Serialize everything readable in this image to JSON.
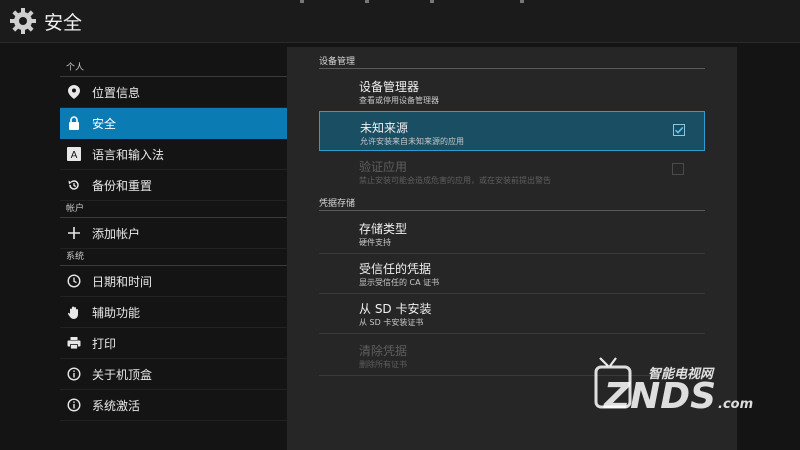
{
  "header": {
    "title": "安全",
    "icon": "gear-icon"
  },
  "sidebar": {
    "groups": [
      {
        "label": "个人",
        "items": [
          {
            "label": "位置信息",
            "icon": "location-pin-icon"
          },
          {
            "label": "安全",
            "icon": "lock-icon",
            "active": true
          },
          {
            "label": "语言和输入法",
            "icon": "keyboard-a-icon"
          },
          {
            "label": "备份和重置",
            "icon": "backup-icon"
          }
        ]
      },
      {
        "label": "帐户",
        "items": [
          {
            "label": "添加帐户",
            "icon": "plus-icon"
          }
        ]
      },
      {
        "label": "系统",
        "items": [
          {
            "label": "日期和时间",
            "icon": "clock-icon"
          },
          {
            "label": "辅助功能",
            "icon": "hand-icon"
          },
          {
            "label": "打印",
            "icon": "printer-icon"
          },
          {
            "label": "关于机顶盒",
            "icon": "info-icon"
          },
          {
            "label": "系统激活",
            "icon": "info-icon"
          }
        ]
      }
    ]
  },
  "main": {
    "sections": [
      {
        "header": "设备管理",
        "items": [
          {
            "title": "设备管理器",
            "summary": "查看或停用设备管理器"
          },
          {
            "title": "未知来源",
            "summary": "允许安装来自未知来源的应用",
            "checkbox": true,
            "checked": true,
            "selected": true
          },
          {
            "title": "验证应用",
            "summary": "禁止安装可能会造成危害的应用，或在安装前提出警告",
            "checkbox": true,
            "checked": false,
            "disabled": true
          }
        ]
      },
      {
        "header": "凭据存储",
        "items": [
          {
            "title": "存储类型",
            "summary": "硬件支持"
          },
          {
            "title": "受信任的凭据",
            "summary": "显示受信任的 CA 证书"
          },
          {
            "title": "从 SD 卡安装",
            "summary": "从 SD 卡安装证书"
          },
          {
            "title": "清除凭据",
            "summary": "删除所有证书",
            "disabled": true
          }
        ]
      }
    ]
  },
  "watermark": {
    "top": "智能电视网",
    "main": "ZNDS",
    "suffix": ".com"
  },
  "colors": {
    "accent": "#0b7bb3",
    "selected_bg": "#1a4e63",
    "panel": "#262626"
  }
}
